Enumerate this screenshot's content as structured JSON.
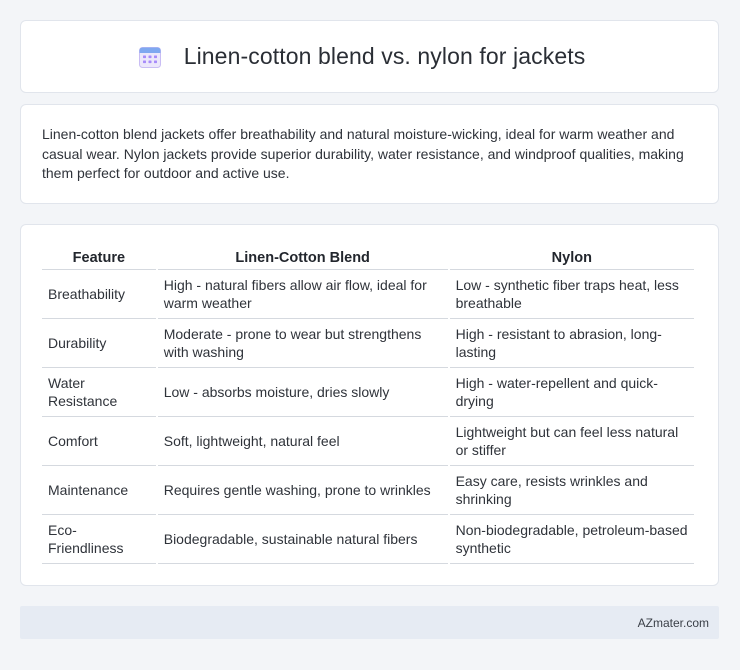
{
  "header": {
    "title": "Linen-cotton blend vs. nylon for jackets",
    "icon": "calendar-icon"
  },
  "summary": {
    "text": "Linen-cotton blend jackets offer breathability and natural moisture-wicking, ideal for warm weather and casual wear. Nylon jackets provide superior durability, water resistance, and windproof qualities, making them perfect for outdoor and active use."
  },
  "table": {
    "headers": [
      "Feature",
      "Linen-Cotton Blend",
      "Nylon"
    ],
    "rows": [
      [
        "Breathability",
        "High - natural fibers allow air flow, ideal for warm weather",
        "Low - synthetic fiber traps heat, less breathable"
      ],
      [
        "Durability",
        "Moderate - prone to wear but strengthens with washing",
        "High - resistant to abrasion, long-lasting"
      ],
      [
        "Water Resistance",
        "Low - absorbs moisture, dries slowly",
        "High - water-repellent and quick-drying"
      ],
      [
        "Comfort",
        "Soft, lightweight, natural feel",
        "Lightweight but can feel less natural or stiffer"
      ],
      [
        "Maintenance",
        "Requires gentle washing, prone to wrinkles",
        "Easy care, resists wrinkles and shrinking"
      ],
      [
        "Eco-Friendliness",
        "Biodegradable, sustainable natural fibers",
        "Non-biodegradable, petroleum-based synthetic"
      ]
    ]
  },
  "footer": {
    "text": "AZmater.com"
  },
  "colors": {
    "page_background": "#f3f5f8",
    "card_background": "#ffffff",
    "footer_background": "#e6ebf3",
    "icon_accent": "#a78bfa"
  }
}
